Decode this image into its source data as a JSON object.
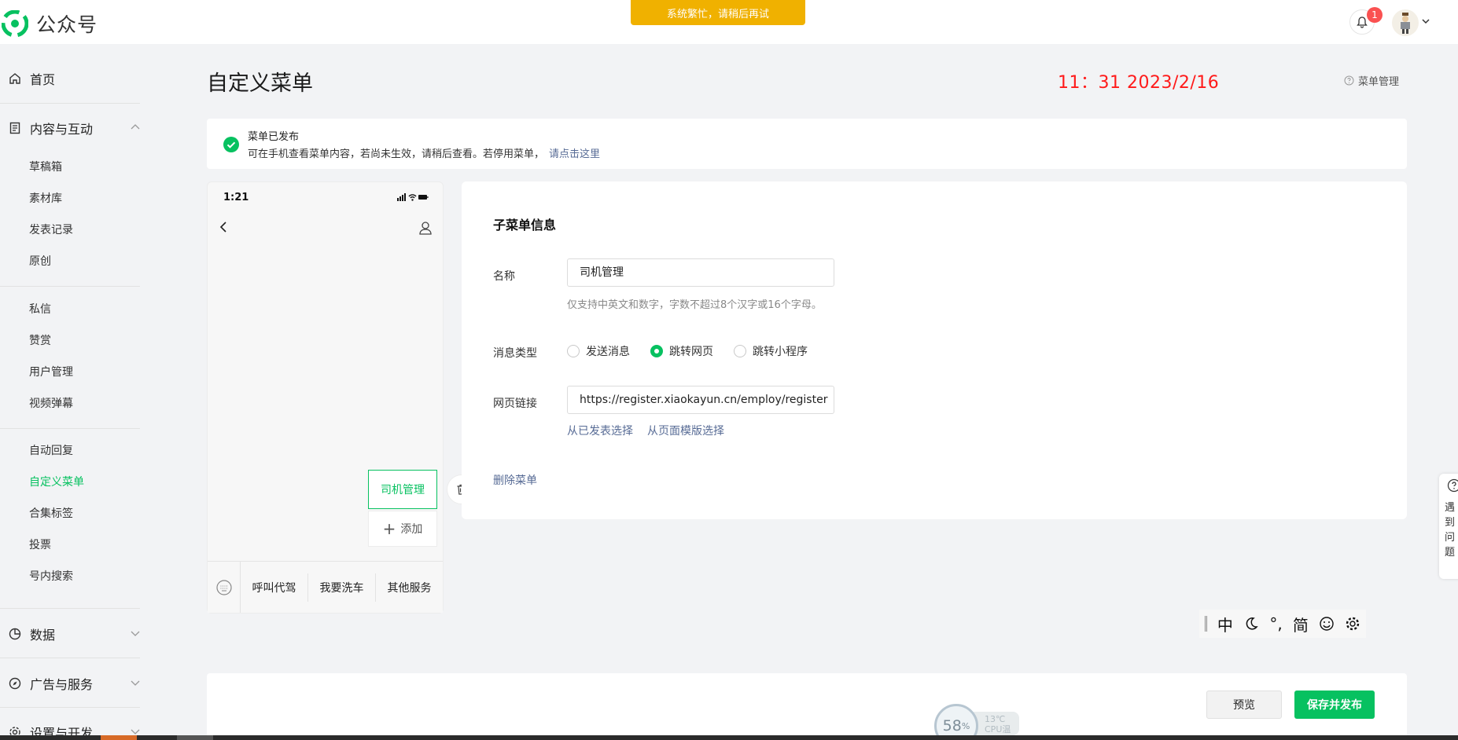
{
  "app": {
    "title": "公众号",
    "brand_color": "#07c160"
  },
  "top": {
    "banner": "系统繁忙，请稍后再试",
    "notification_count": "1"
  },
  "sidebar": {
    "home": "首页",
    "content_group": "内容与互动",
    "content_items": [
      "草稿箱",
      "素材库",
      "发表记录",
      "原创"
    ],
    "interaction_items": [
      "私信",
      "赞赏",
      "用户管理",
      "视频弹幕"
    ],
    "function_items": [
      "自动回复",
      "自定义菜单",
      "合集标签",
      "投票",
      "号内搜索"
    ],
    "data_group": "数据",
    "ads_group": "广告与服务",
    "settings_group": "设置与开发"
  },
  "page": {
    "title": "自定义菜单",
    "clock": "11：31  2023/2/16",
    "help": "菜单管理"
  },
  "notice": {
    "title": "菜单已发布",
    "desc": "可在手机查看菜单内容，若尚未生效，请稍后查看。若停用菜单，",
    "link": "请点击这里"
  },
  "phone": {
    "time": "1:21",
    "submenu_active": "司机管理",
    "submenu_add": "添加",
    "bottom_tabs": [
      "呼叫代驾",
      "我要洗车",
      "其他服务"
    ]
  },
  "editor": {
    "title": "子菜单信息",
    "name_label": "名称",
    "name_value": "司机管理",
    "name_hint": "仅支持中英文和数字，字数不超过8个汉字或16个字母。",
    "type_label": "消息类型",
    "type_options": [
      "发送消息",
      "跳转网页",
      "跳转小程序"
    ],
    "type_selected": "跳转网页",
    "url_label": "网页链接",
    "url_value": "https://register.xiaokayun.cn/employ/register",
    "pick_published": "从已发表选择",
    "pick_template": "从页面模版选择",
    "delete": "删除菜单"
  },
  "ime": {
    "mode": "中",
    "width_char": "°,",
    "script": "简"
  },
  "feedback": {
    "chars": [
      "遇",
      "到",
      "问",
      "题"
    ]
  },
  "actions": {
    "preview": "预览",
    "save": "保存并发布"
  },
  "cpu": {
    "percent": "58",
    "unit": "%",
    "temp": "13℃",
    "label": "CPU温度"
  }
}
